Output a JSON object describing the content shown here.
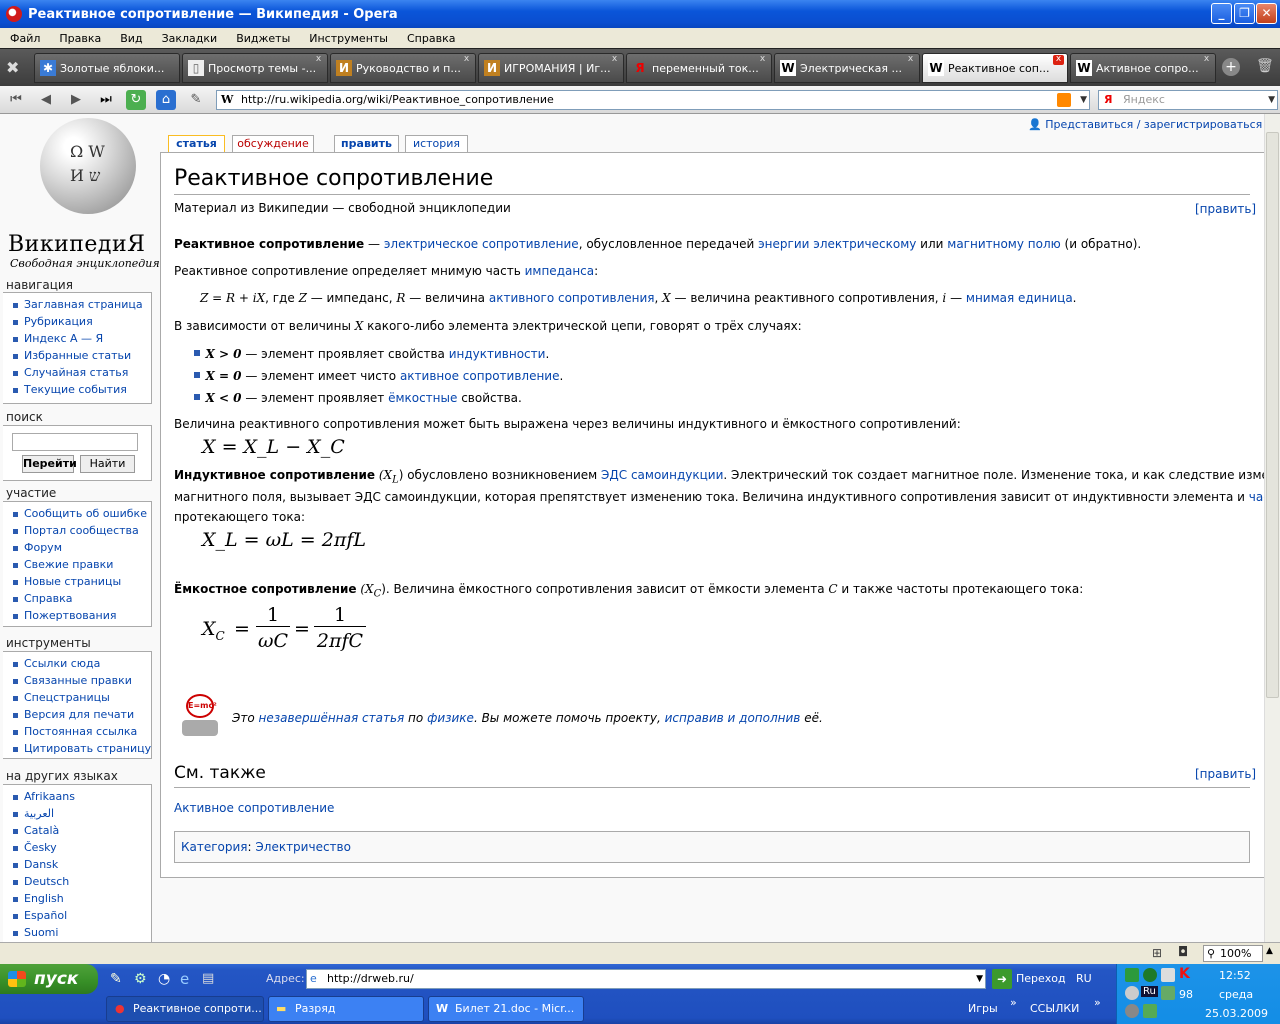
{
  "window": {
    "title": "Реактивное сопротивление — Википедия - Opera"
  },
  "menu": [
    "Файл",
    "Правка",
    "Вид",
    "Закладки",
    "Виджеты",
    "Инструменты",
    "Справка"
  ],
  "tabs": [
    {
      "label": "Золотые яблоки...",
      "icon": "tutby-icon"
    },
    {
      "label": "Просмотр темы -...",
      "icon": "page-icon"
    },
    {
      "label": "Руководство и п...",
      "icon": "igromania-icon"
    },
    {
      "label": "ИГРОМАНИЯ | Иг...",
      "icon": "igromania-icon"
    },
    {
      "label": "переменный ток...",
      "icon": "yandex-icon"
    },
    {
      "label": "Электрическая ...",
      "icon": "wikipedia-icon"
    },
    {
      "label": "Реактивное соп...",
      "icon": "wikipedia-icon",
      "active": true
    },
    {
      "label": "Активное сопро...",
      "icon": "wikipedia-icon"
    }
  ],
  "address": {
    "url": "http://ru.wikipedia.org/wiki/Реактивное_сопротивление",
    "search_placeholder": "Яндекс",
    "search_logo": "Я"
  },
  "wiki": {
    "logo_title": "ВикипедиЯ",
    "logo_subtitle": "Свободная энциклопедия",
    "login": "Представиться / зарегистрироваться",
    "tabs": {
      "article": "статья",
      "discussion": "обсуждение",
      "edit": "править",
      "history": "история"
    },
    "nav_heading": "навигация",
    "nav": [
      "Заглавная страница",
      "Рубрикация",
      "Индекс А — Я",
      "Избранные статьи",
      "Случайная статья",
      "Текущие события"
    ],
    "search_heading": "поиск",
    "search_go": "Перейти",
    "search_find": "Найти",
    "participate_heading": "участие",
    "participate": [
      "Сообщить об ошибке",
      "Портал сообщества",
      "Форум",
      "Свежие правки",
      "Новые страницы",
      "Справка",
      "Пожертвования"
    ],
    "tools_heading": "инструменты",
    "tools": [
      "Ссылки сюда",
      "Связанные правки",
      "Спецстраницы",
      "Версия для печати",
      "Постоянная ссылка",
      "Цитировать страницу"
    ],
    "lang_heading": "на других языках",
    "langs": [
      "Afrikaans",
      "العربية",
      "Català",
      "Česky",
      "Dansk",
      "Deutsch",
      "English",
      "Español",
      "Suomi"
    ]
  },
  "article": {
    "title": "Реактивное сопротивление",
    "source": "Материал из Википедии — свободной энциклопедии",
    "edit": "[править]",
    "p1_b": "Реактивное сопротивление",
    "p1_a": " — ",
    "p1_l1": "электрическое сопротивление",
    "p1_b2": ", обусловленное передачей ",
    "p1_l2": "энергии электрическому",
    "p1_c": " или ",
    "p1_l3": "магнитному полю",
    "p1_d": " (и обратно).",
    "p2": "Реактивное сопротивление определяет мнимую часть ",
    "p2_l": "импеданса",
    "p2_e": ":",
    "def_a": "Z = R + iX",
    "def_b": ", где ",
    "def_z": "Z",
    "def_c": " — импеданс, ",
    "def_r": "R",
    "def_d": " — величина ",
    "def_l1": "активного сопротивления",
    "def_e": ", ",
    "def_x": "X",
    "def_f": " — величина реактивного сопротивления, ",
    "def_i": "i",
    "def_g": " — ",
    "def_l2": "мнимая единица",
    "p3_a": "В зависимости от величины ",
    "p3_x": "X",
    "p3_b": " какого-либо элемента электрической цепи, говорят о трёх случаях:",
    "b1_m": "X > 0",
    "b1_t": " — элемент проявляет свойства ",
    "b1_l": "индуктивности",
    "b2_m": "X = 0",
    "b2_t": " — элемент имеет чисто ",
    "b2_l": "активное сопротивление",
    "b3_m": "X < 0",
    "b3_t": " — элемент проявляет ",
    "b3_l": "ёмкостные",
    "b3_e": " свойства.",
    "p4": "Величина реактивного сопротивления может быть выражена через величины индуктивного и ёмкостного сопротивлений:",
    "eq1": "X = X_L − X_C",
    "ind_b": "Индуктивное сопротивление",
    "ind_a": " (X",
    "ind_sub": "L",
    "ind_c": ") обусловлено возникновением ",
    "ind_l": "ЭДС самоиндукции",
    "ind_d": ". Электрический ток создает магнитное поле. Изменение тока, и как следствие изменение",
    "ind_line2": "магнитного поля, вызывает ЭДС самоиндукции, которая препятствует изменению тока. Величина индуктивного сопротивления зависит от индуктивности элемента и ",
    "ind_l2": "частоты",
    "ind_line3": "протекающего тока:",
    "eq2": "X_L = ωL = 2πfL",
    "cap_b": "Ёмкостное сопротивление",
    "cap_a": " (X",
    "cap_sub": "C",
    "cap_c": "). Величина ёмкостного сопротивления зависит от ёмкости элемента ",
    "cap_cc": "C",
    "cap_d": " и также частоты протекающего тока:",
    "eq3_lhs": "X",
    "eq3_sub": "C",
    "eq3_num": "1",
    "eq3_den1": "ωC",
    "eq3_den2": "2πfC",
    "stub_icon": "E=mc²",
    "stub_a": "Это ",
    "stub_l1": "незавершённая статья",
    "stub_b": " по ",
    "stub_l2": "физике",
    "stub_c": ". Вы можете помочь проекту, ",
    "stub_l3": "исправив и дополнив",
    "stub_d": " её.",
    "see_also": "См. также",
    "see_link": "Активное сопротивление",
    "cat_label": "Категория",
    "cat_link": "Электричество"
  },
  "status": {
    "zoom": "100%"
  },
  "taskbar": {
    "start": "пуск",
    "addr_label": "Адрес:",
    "addr_value": "http://drweb.ru/",
    "go": "Переход",
    "lang": "RU",
    "items": [
      "Реактивное сопроти...",
      "Разряд",
      "Билет 21.doc - Micr..."
    ],
    "games": "Игры",
    "links": "ССЫЛКИ",
    "tray_lang": "Ru",
    "tray_num": "98",
    "time": "12:52",
    "day": "среда",
    "date": "25.03.2009"
  }
}
